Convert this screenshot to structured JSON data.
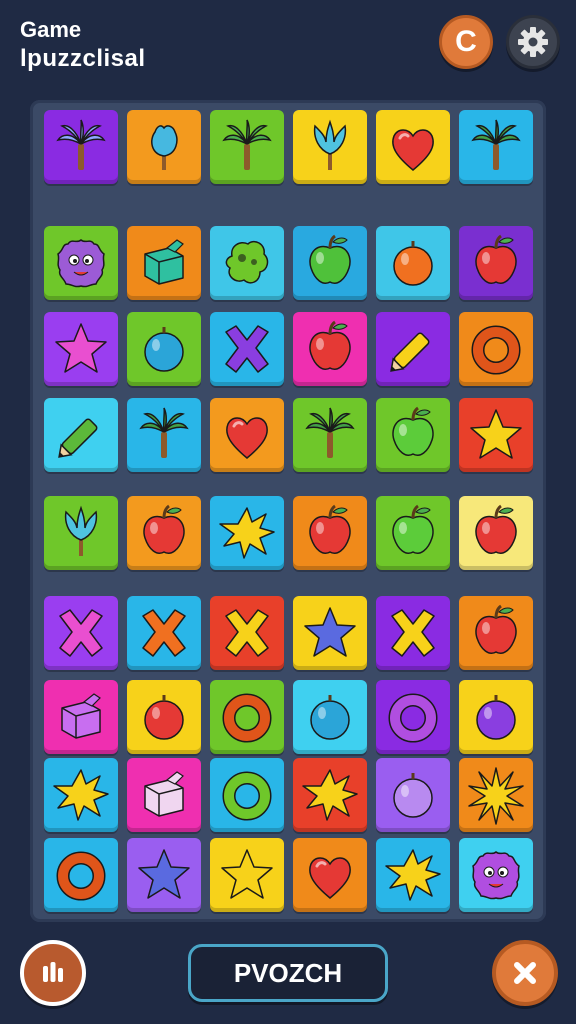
{
  "header": {
    "title_line1": "Game",
    "title_line2": "lpuzzclisal",
    "restart_button_label": "C"
  },
  "bottom_bar": {
    "center_button_label": "PVOZCH"
  },
  "colors": {
    "background": "#1f2a44",
    "board": "#3b4a66",
    "accent_orange": "#e07a3a",
    "center_button_border": "#4aa6c8"
  },
  "board": {
    "columns": 6,
    "rows": 9,
    "tiles": [
      [
        {
          "color": "#8a2be2",
          "icon": "palm-tree",
          "fg": "#8fa8ff"
        },
        {
          "color": "#f39a1e",
          "icon": "bud",
          "fg": "#46b8e0"
        },
        {
          "color": "#6fc72a",
          "icon": "palm-tree",
          "fg": "#4caf50"
        },
        {
          "color": "#f7d21a",
          "icon": "tulip",
          "fg": "#4fc3e0"
        },
        {
          "color": "#f7d21a",
          "icon": "heart",
          "fg": "#e53935"
        },
        {
          "color": "#29b6e8",
          "icon": "palm-tree",
          "fg": "#43a047"
        }
      ],
      [
        {
          "color": "#6fc72a",
          "icon": "monster",
          "fg": "#9c5bd6"
        },
        {
          "color": "#f08a1a",
          "icon": "cube",
          "fg": "#2fc0a0"
        },
        {
          "color": "#3fc6e8",
          "icon": "blob",
          "fg": "#6fc72a"
        },
        {
          "color": "#29a9e0",
          "icon": "apple",
          "fg": "#4fc13a"
        },
        {
          "color": "#3fc6e8",
          "icon": "fruit",
          "fg": "#f07020"
        },
        {
          "color": "#7a2fd0",
          "icon": "apple",
          "fg": "#e53935"
        }
      ],
      [
        {
          "color": "#9a3ef0",
          "icon": "star",
          "fg": "#e94fd0"
        },
        {
          "color": "#6fc72a",
          "icon": "fruit",
          "fg": "#2ba5d8"
        },
        {
          "color": "#29b6e8",
          "icon": "cross",
          "fg": "#8a3ee0"
        },
        {
          "color": "#ef2fb0",
          "icon": "apple",
          "fg": "#e53935"
        },
        {
          "color": "#8a2be2",
          "icon": "pencil",
          "fg": "#f7d21a"
        },
        {
          "color": "#f08a1a",
          "icon": "ring",
          "fg": "#e0551a"
        }
      ],
      [
        {
          "color": "#3fd0f0",
          "icon": "pencil",
          "fg": "#5cb83a"
        },
        {
          "color": "#29b6e8",
          "icon": "palm-tree",
          "fg": "#43a047"
        },
        {
          "color": "#f39a1e",
          "icon": "heart",
          "fg": "#e53935"
        },
        {
          "color": "#6fc72a",
          "icon": "palm-tree",
          "fg": "#43a047"
        },
        {
          "color": "#6fc72a",
          "icon": "apple",
          "fg": "#5ccc3a"
        },
        {
          "color": "#e8402a",
          "icon": "star",
          "fg": "#f7d21a"
        }
      ],
      [
        {
          "color": "#6fc72a",
          "icon": "tulip",
          "fg": "#4fc3e0"
        },
        {
          "color": "#f39a1e",
          "icon": "apple",
          "fg": "#e53935"
        },
        {
          "color": "#29b6e8",
          "icon": "splat",
          "fg": "#f7d21a"
        },
        {
          "color": "#f08a1a",
          "icon": "apple",
          "fg": "#e53935"
        },
        {
          "color": "#6fc72a",
          "icon": "apple",
          "fg": "#5ccc3a"
        },
        {
          "color": "#f7e87a",
          "icon": "apple",
          "fg": "#e53935"
        }
      ],
      [
        {
          "color": "#9a3ef0",
          "icon": "cross",
          "fg": "#e94fd0"
        },
        {
          "color": "#29b6e8",
          "icon": "cross",
          "fg": "#f07020"
        },
        {
          "color": "#e8402a",
          "icon": "cross",
          "fg": "#f7d21a"
        },
        {
          "color": "#f7d21a",
          "icon": "star",
          "fg": "#5a6ae0"
        },
        {
          "color": "#8a2be2",
          "icon": "cross",
          "fg": "#f7d21a"
        },
        {
          "color": "#f08a1a",
          "icon": "apple",
          "fg": "#e53935"
        }
      ],
      [
        {
          "color": "#ef2fb0",
          "icon": "cube",
          "fg": "#c86ef0"
        },
        {
          "color": "#f7d21a",
          "icon": "fruit",
          "fg": "#e53935"
        },
        {
          "color": "#6fc72a",
          "icon": "ring",
          "fg": "#e0551a"
        },
        {
          "color": "#3fd0f0",
          "icon": "fruit",
          "fg": "#2ba5d8"
        },
        {
          "color": "#8a2be2",
          "icon": "ring",
          "fg": "#b04ee0"
        },
        {
          "color": "#f7d21a",
          "icon": "fruit",
          "fg": "#8a3ee0"
        }
      ],
      [
        {
          "color": "#29b6e8",
          "icon": "splat",
          "fg": "#f7d21a"
        },
        {
          "color": "#ef2fb0",
          "icon": "cube",
          "fg": "#f0d6f0"
        },
        {
          "color": "#29b6e8",
          "icon": "ring",
          "fg": "#6fc72a"
        },
        {
          "color": "#e8402a",
          "icon": "splat",
          "fg": "#f7d21a"
        },
        {
          "color": "#9a5ef0",
          "icon": "fruit",
          "fg": "#b88af0"
        },
        {
          "color": "#f08a1a",
          "icon": "burst",
          "fg": "#f7d21a"
        }
      ],
      [
        {
          "color": "#29b6e8",
          "icon": "ring",
          "fg": "#e0551a"
        },
        {
          "color": "#9a5ef0",
          "icon": "star",
          "fg": "#5a6ae0"
        },
        {
          "color": "#f7d21a",
          "icon": "star",
          "fg": "#f7d21a"
        },
        {
          "color": "#f08a1a",
          "icon": "heart",
          "fg": "#e53935"
        },
        {
          "color": "#29b6e8",
          "icon": "splat",
          "fg": "#f7d21a"
        },
        {
          "color": "#3fd0f0",
          "icon": "monster",
          "fg": "#b04ee0"
        }
      ]
    ]
  }
}
